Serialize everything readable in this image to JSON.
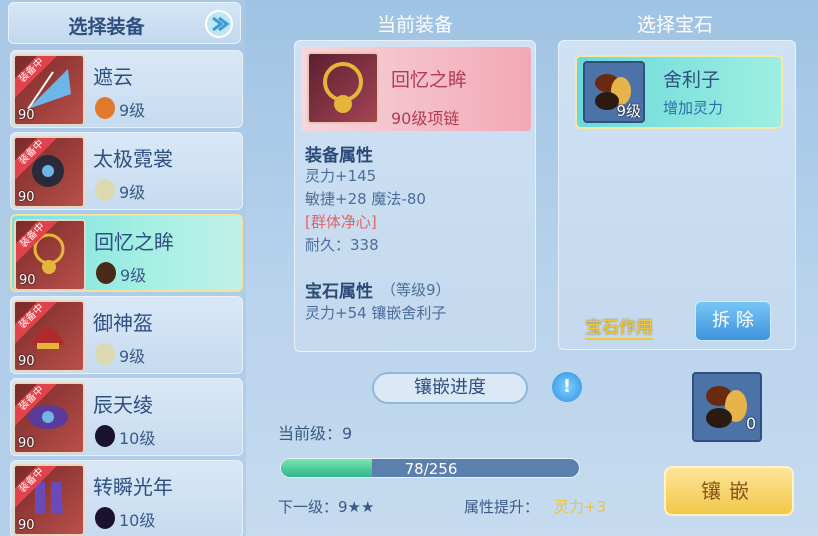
{
  "left": {
    "title": "选择装备",
    "equipped_badge": "装备中",
    "items": [
      {
        "name": "遮云",
        "level": "90",
        "gem_level": "9级",
        "gem_color": "#e07a2a",
        "selected": false
      },
      {
        "name": "太极霓裳",
        "level": "90",
        "gem_level": "9级",
        "gem_color": "#dcd9b0",
        "selected": false
      },
      {
        "name": "回忆之眸",
        "level": "90",
        "gem_level": "9级",
        "gem_color": "#4a2a1a",
        "selected": true
      },
      {
        "name": "御神盔",
        "level": "90",
        "gem_level": "9级",
        "gem_color": "#dcd9b0",
        "selected": false
      },
      {
        "name": "辰天绫",
        "level": "90",
        "gem_level": "10级",
        "gem_color": "#1a1230",
        "selected": false
      },
      {
        "name": "转瞬光年",
        "level": "90",
        "gem_level": "10级",
        "gem_color": "#1a1230",
        "selected": false
      }
    ]
  },
  "current": {
    "title": "当前装备",
    "name": "回忆之眸",
    "type": "90级项链",
    "attr_heading": "装备属性",
    "attrs": [
      "灵力+145",
      "敏捷+28 魔法-80",
      "[群体净心]",
      "耐久：338"
    ],
    "gem_heading": "宝石属性",
    "gem_level": "（等级9）",
    "gem_attr": "灵力+54 镶嵌舍利子"
  },
  "gem": {
    "title": "选择宝石",
    "name": "舍利子",
    "desc": "增加灵力",
    "level": "9级",
    "effect_label": "宝石作用",
    "remove_label": "拆 除"
  },
  "progress": {
    "label": "镶嵌进度",
    "current_level": "当前级：9",
    "text": "78/256",
    "value": 78,
    "max": 256,
    "next_level": "下一级：9★★",
    "boost_label": "属性提升：",
    "boost_value": "灵力+3",
    "help": "!",
    "slot_count": "0",
    "inlay_label": "镶嵌"
  }
}
